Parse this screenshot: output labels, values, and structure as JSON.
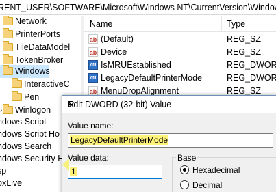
{
  "address_bar": {
    "path": "RENT_USER\\SOFTWARE\\Microsoft\\Windows NT\\CurrentVersion\\Windows"
  },
  "tree": {
    "items": [
      {
        "label": "Network"
      },
      {
        "label": "PrinterPorts"
      },
      {
        "label": "TileDataModel"
      },
      {
        "label": "TokenBroker"
      },
      {
        "label": "Windows"
      },
      {
        "label": "InteractiveC"
      },
      {
        "label": "Pen"
      },
      {
        "label": "Winlogon"
      },
      {
        "label": "ndows Script"
      },
      {
        "label": "ndows Script Ho"
      },
      {
        "label": "ndows Search"
      },
      {
        "label": "ndows Security H"
      },
      {
        "label": "sp"
      },
      {
        "label": "oxLive"
      }
    ]
  },
  "list": {
    "columns": {
      "name": "Name",
      "type": "Type"
    },
    "rows": [
      {
        "icon": "string-value-icon",
        "name": "(Default)",
        "type": "REG_SZ"
      },
      {
        "icon": "string-value-icon",
        "name": "Device",
        "type": "REG_SZ"
      },
      {
        "icon": "dword-value-icon",
        "name": "IsMRUEstablished",
        "type": "REG_DWORD"
      },
      {
        "icon": "dword-value-icon",
        "name": "LegacyDefaultPrinterMode",
        "type": "REG_DWORD"
      },
      {
        "icon": "string-value-icon",
        "name": "MenuDropAlignment",
        "type": "REG_SZ"
      }
    ]
  },
  "dialog": {
    "title": "Edit DWORD (32-bit) Value",
    "value_name_label": "Value name:",
    "value_name": "LegacyDefaultPrinterMode",
    "value_data_label": "Value data:",
    "value_data": "1",
    "base_label": "Base",
    "base_options": [
      "Hexadecimal",
      "Decimal"
    ],
    "base_selected": "Hexadecimal",
    "close_glyph": "✕"
  },
  "colors": {
    "highlight": "#fff27a",
    "selection": "#cce8ff",
    "accent": "#0078d7"
  }
}
